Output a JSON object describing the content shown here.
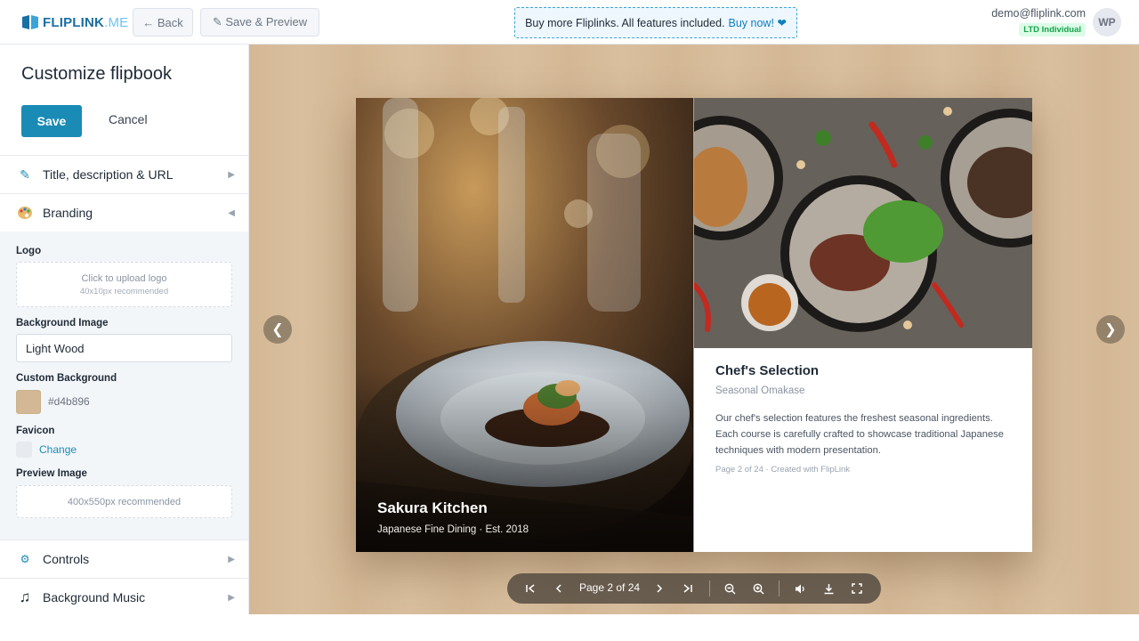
{
  "topbar": {
    "logo_main": "FLIPLINK",
    "logo_suffix": ".ME",
    "back_label": "← Back",
    "save_preview_label": "✎ Save & Preview",
    "promo_text": "Buy more Fliplinks. All features included.",
    "promo_link": "Buy now! ❤",
    "user_email": "demo@fliplink.com",
    "user_plan": "LTD Individual",
    "avatar_initials": "WP"
  },
  "sidebar": {
    "title": "Customize flipbook",
    "save_label": "Save",
    "cancel_label": "Cancel",
    "sections": {
      "title_desc": "Title, description & URL",
      "branding": "Branding",
      "controls": "Controls",
      "music": "Background Music"
    },
    "branding": {
      "logo_label": "Logo",
      "logo_upload_text": "Click to upload logo",
      "logo_upload_hint": "40x10px recommended",
      "bg_image_label": "Background Image",
      "bg_image_value": "Light Wood",
      "custom_bg_label": "Custom Background",
      "custom_bg_hex": "#d4b896",
      "favicon_label": "Favicon",
      "favicon_change": "Change",
      "preview_label": "Preview Image",
      "preview_hint": "400x550px recommended"
    }
  },
  "book": {
    "left_title": "Sakura Kitchen",
    "left_subtitle": "Japanese Fine Dining · Est. 2018",
    "right_title": "Chef's Selection",
    "right_subtitle": "Seasonal Omakase",
    "right_body": "Our chef's selection features the freshest seasonal ingredients. Each course is carefully crafted to showcase traditional Japanese techniques with modern presentation.",
    "right_footer": "Page 2 of 24 · Created with FlipLink"
  },
  "nav": {
    "prev": "❮",
    "next": "❯"
  },
  "toolbar": {
    "page_indicator": "Page 2 of 24"
  },
  "colors": {
    "accent": "#1a8bb5",
    "canvas_bg": "#d4b896"
  }
}
